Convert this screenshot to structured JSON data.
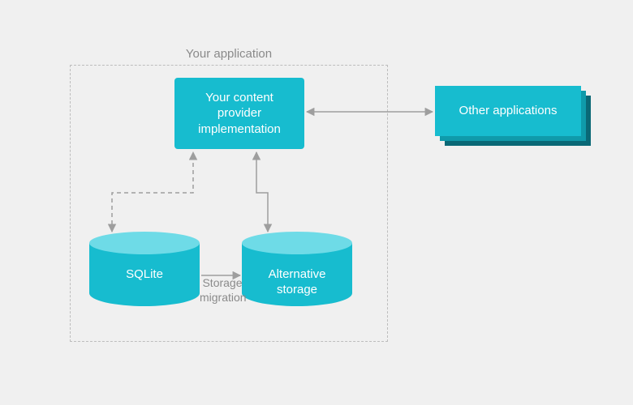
{
  "container_label": "Your application",
  "content_provider_label": "Your content\nprovider\nimplementation",
  "other_apps_label": "Other applications",
  "sqlite_label": "SQLite",
  "alt_storage_label": "Alternative\nstorage",
  "storage_migration_label": "Storage\nmigration",
  "colors": {
    "teal": "#17bccf",
    "teal_light": "#6edbe7",
    "teal_dark1": "#0f9aaa",
    "teal_dark2": "#0a6876",
    "grey": "#9e9e9e"
  }
}
